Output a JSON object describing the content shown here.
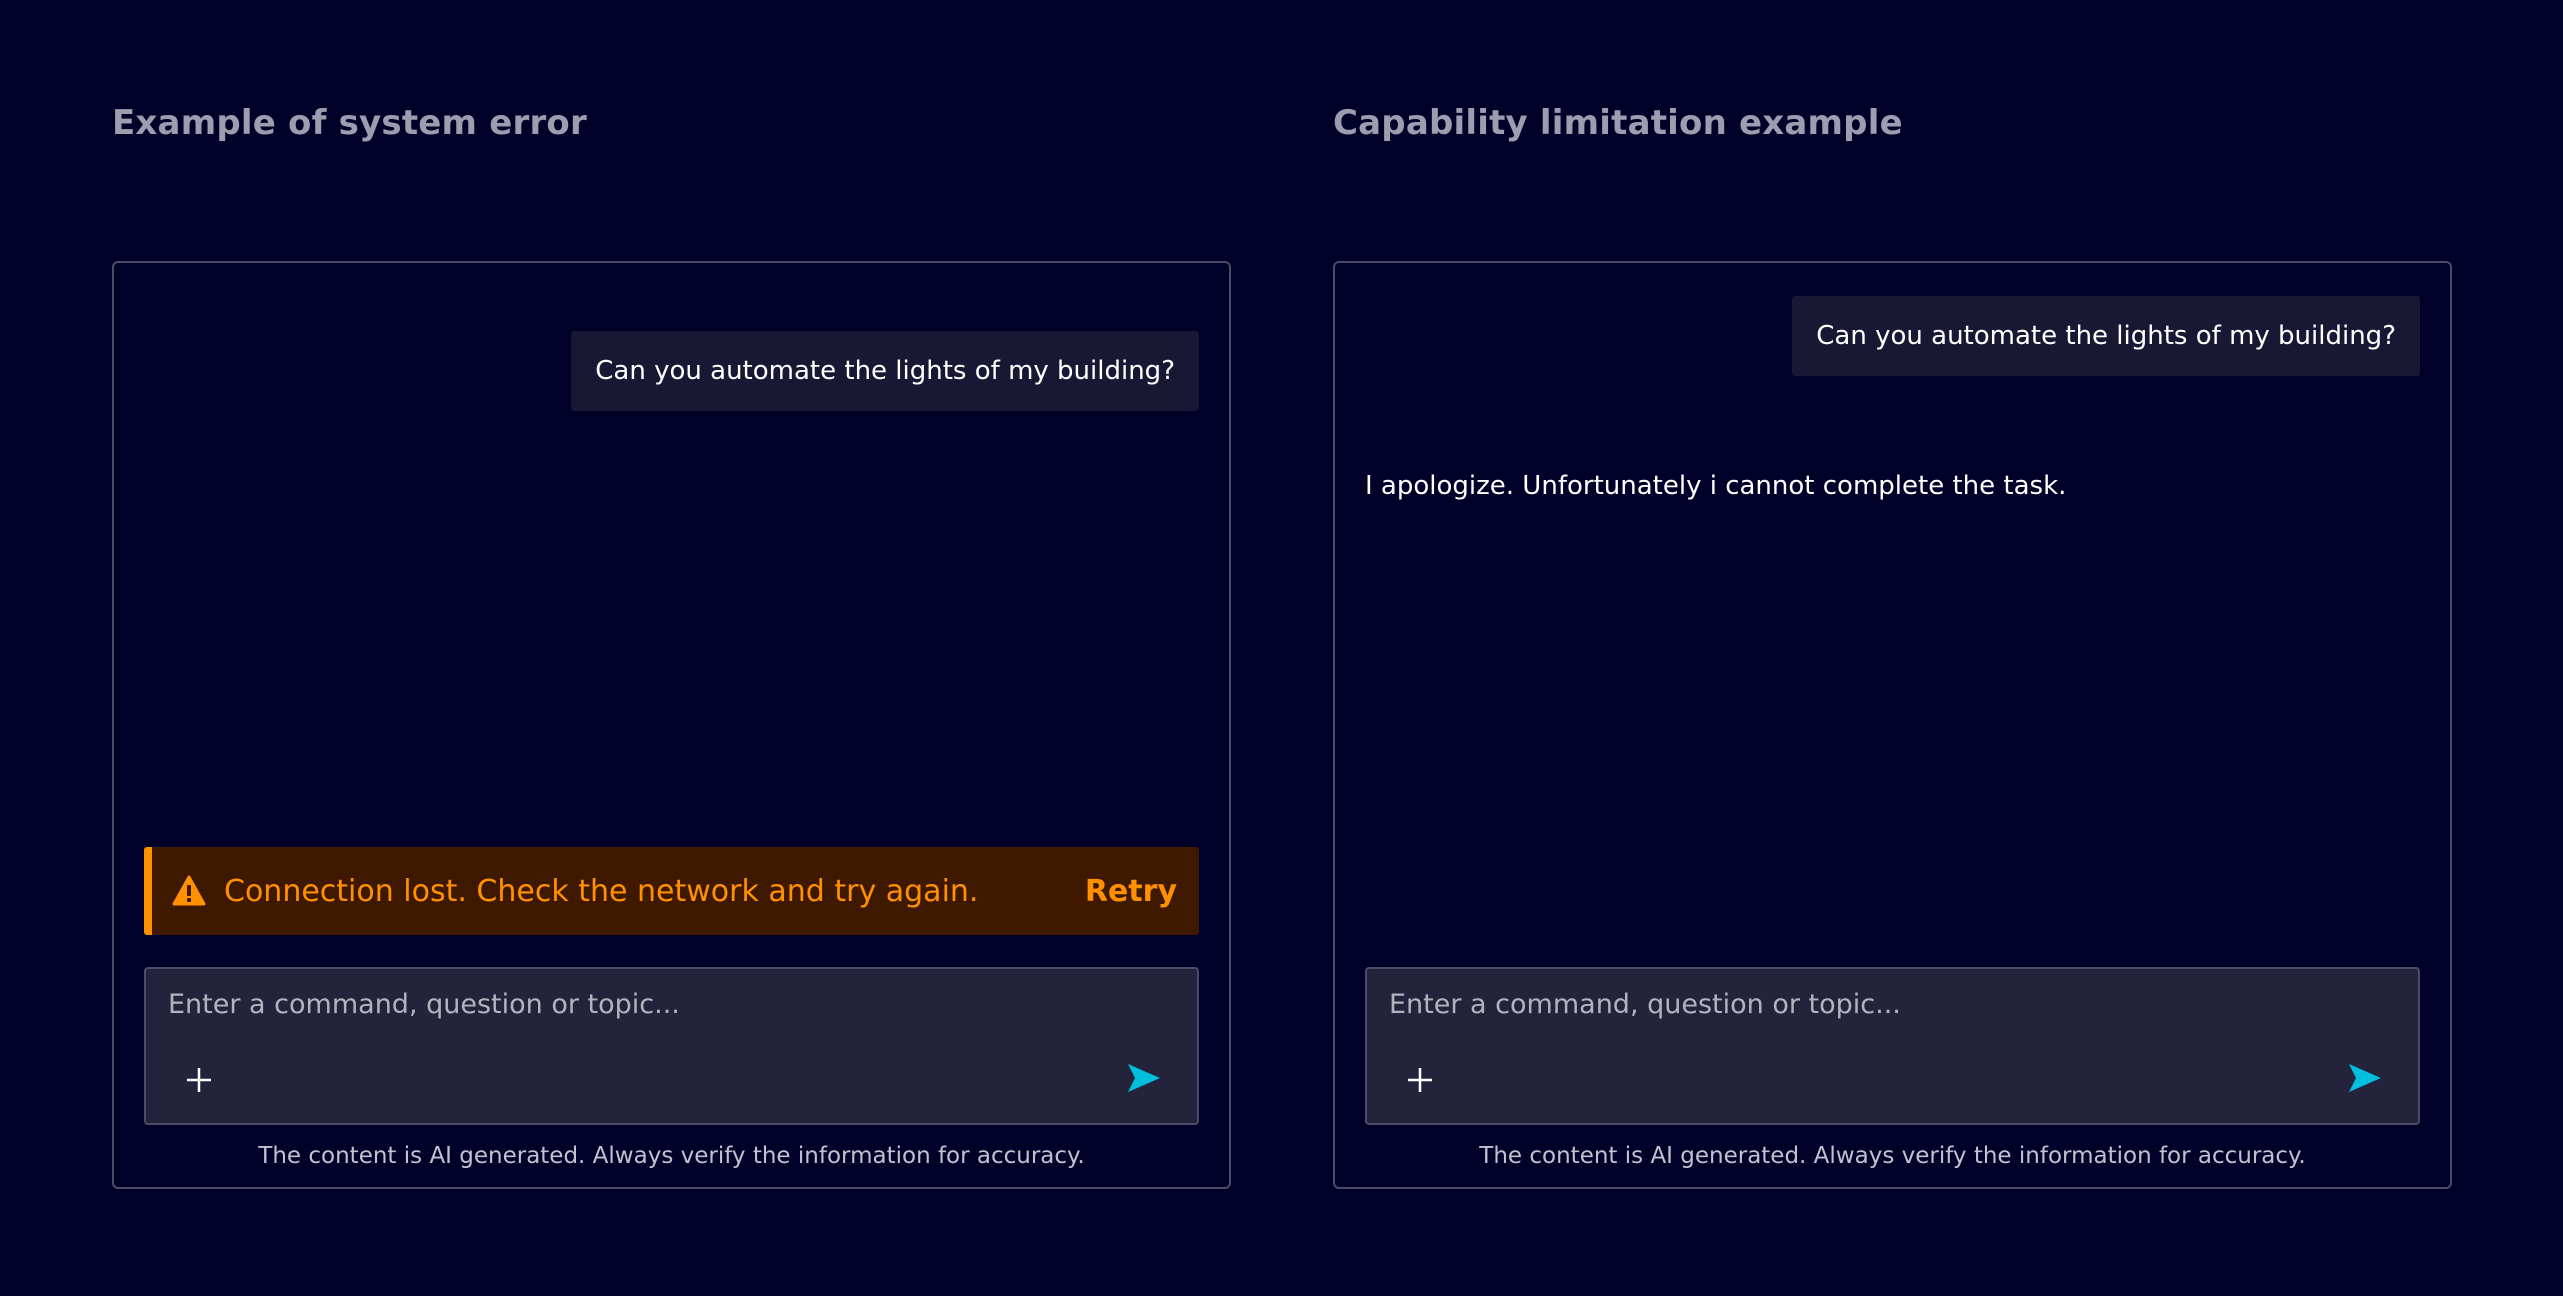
{
  "sections": [
    {
      "title": "Example of system error",
      "user_message": "Can you automate the lights of my building?",
      "alert": {
        "text": "Connection lost. Check the network and try again.",
        "action": "Retry",
        "color": "#ff9000"
      },
      "composer": {
        "placeholder": "Enter a command, question or topic..."
      },
      "disclaimer": "The content is AI generated. Always verify the information for accuracy."
    },
    {
      "title": "Capability limitation example",
      "user_message": "Can you automate the lights of my building?",
      "assistant_message": "I apologize. Unfortunately i cannot complete the task.",
      "composer": {
        "placeholder": "Enter a command, question or topic..."
      },
      "disclaimer": "The content is AI generated. Always verify the information for accuracy."
    }
  ],
  "icons": {
    "warning": "warning-icon",
    "add": "plus-icon",
    "send": "send-icon"
  },
  "colors": {
    "background": "#000028",
    "accent": "#00bedc",
    "warning": "#ff9000"
  }
}
